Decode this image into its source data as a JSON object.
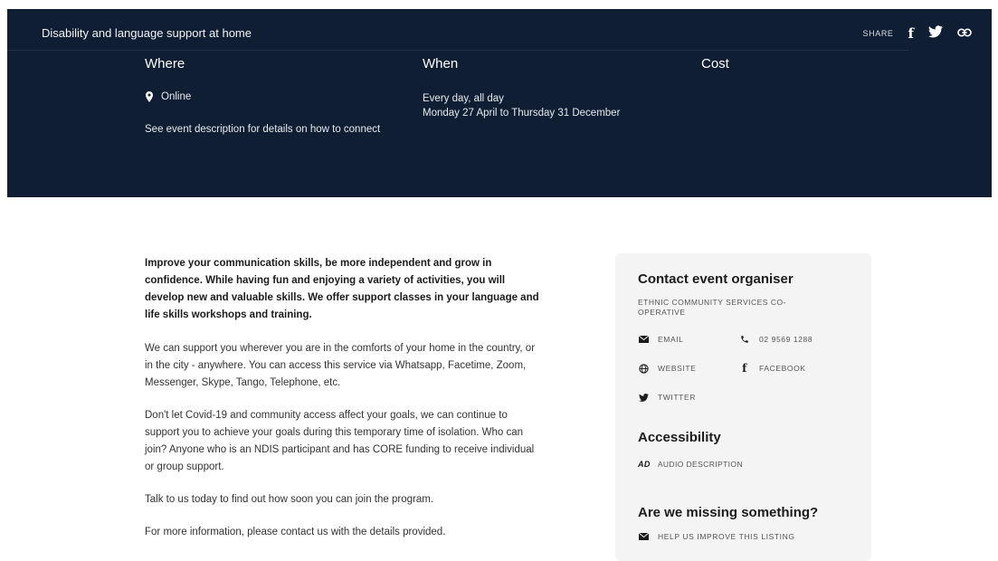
{
  "hero": {
    "title": "Disability and language support at home",
    "share_label": "SHARE",
    "share_icons": [
      "facebook-icon",
      "twitter-icon",
      "link-icon"
    ],
    "where": {
      "heading": "Where",
      "location": "Online",
      "note": "See event description for details on how to connect"
    },
    "when": {
      "heading": "When",
      "line1": "Every day, all day",
      "line2": "Monday 27 April to Thursday 31 December"
    },
    "cost": {
      "heading": "Cost"
    }
  },
  "description": {
    "lead": "Improve your communication skills, be more independent and grow in confidence. While having fun and enjoying a variety of activities, you will develop new and valuable skills. We offer support classes in your language and life skills workshops and training.",
    "paragraphs": [
      "We can support you wherever you are in the comforts of your home in the country, or in the city - anywhere. You can access this service via Whatsapp, Facetime, Zoom, Messenger, Skype, Tango, Telephone, etc.",
      "Don't let Covid-19 and community access affect your goals, we can continue to support you to achieve your goals during this temporary time of isolation. Who can join? Anyone who is an NDIS participant and has CORE funding to receive individual or group support.",
      "Talk to us today to find out how soon you can join the program.",
      "For more information, please contact us with the details provided."
    ]
  },
  "sidebar": {
    "contact_heading": "Contact event organiser",
    "organiser": "ETHNIC COMMUNITY SERVICES CO-OPERATIVE",
    "contacts": {
      "email": "EMAIL",
      "phone": "02 9569 1288",
      "website": "WEBSITE",
      "facebook": "FACEBOOK",
      "twitter": "TWITTER"
    },
    "accessibility_heading": "Accessibility",
    "accessibility_item": "AUDIO DESCRIPTION",
    "missing_heading": "Are we missing something?",
    "help_link": "HELP US IMPROVE THIS LISTING"
  }
}
